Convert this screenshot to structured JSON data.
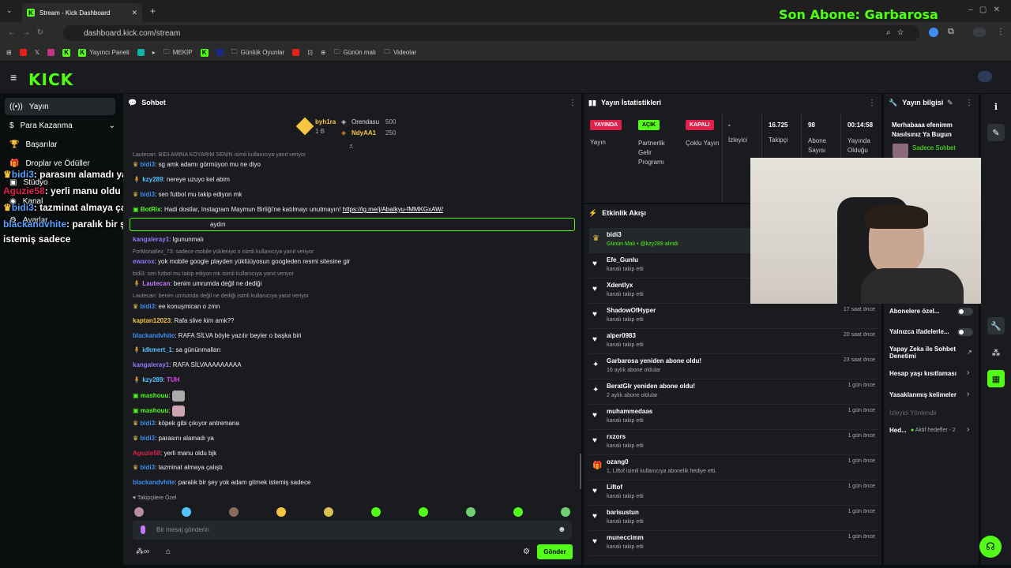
{
  "browser": {
    "tab_title": "Stream - Kick Dashboard",
    "url": "dashboard.kick.com/stream",
    "bookmarks": [
      "Yayıncı Paneli",
      "MEKİP",
      "Günlük Oyunlar",
      "Günün malı",
      "Videolar"
    ]
  },
  "overlay": {
    "last_sub": "Son Abone: Garbarosa",
    "chat_lines": [
      {
        "user": "bidi3",
        "text": ": parasını alamadı ya"
      },
      {
        "user": "Aguzie58",
        "text": ": yerli manu oldu bjk"
      },
      {
        "user": "bidi3",
        "text": ": tazminat almaya çalıştı"
      },
      {
        "user": "blackandvhite",
        "text": ": paralık bir şey yok adam gitmek"
      },
      {
        "user": "",
        "text": "istemiş sadece"
      }
    ]
  },
  "sidebar": {
    "items": [
      {
        "label": "Yayın"
      },
      {
        "label": "Para Kazanma"
      },
      {
        "label": "Başarılar"
      },
      {
        "label": "Droplar ve Ödüller"
      },
      {
        "label": "Stüdyo"
      },
      {
        "label": "Kanal"
      },
      {
        "label": "Ayarlar"
      }
    ]
  },
  "chat": {
    "title": "Sohbet",
    "leaderboard": {
      "first_user": "byh1ra",
      "first_sub": "1 B",
      "second_user": "Orendasu",
      "second_amount": "500",
      "third_user": "NdyAA1",
      "third_amount": "250"
    },
    "messages": [
      {
        "reply": "Lautecan: BİDİ AMINA KOYARIM SENİN isimli kullanıcıya yanıt veriyor",
        "user": "bidi3",
        "text": ": sg amk adamı görmüyon mu ne diyo",
        "color": "#3d8df5"
      },
      {
        "user": "kzy289",
        "text": ": nereye uzuyo kel abim",
        "color": "#53c3ff"
      },
      {
        "user": "bidi3",
        "text": ": sen futbol mu takip ediyon mk",
        "color": "#3d8df5"
      },
      {
        "user": "BotRix",
        "text": ": Hadi dostlar, Instagram Maymun Birliği'ne katılmayı unutmayın!",
        "link": "https://ig.me/j/AbaIkyu-fMMKGxAW/",
        "color": "#53fc18"
      },
      {
        "user": "",
        "text": "aydın",
        "color": "#fff"
      },
      {
        "user": "kangaleray1",
        "text": ": lgununmalı",
        "color": "#8f7af7"
      },
      {
        "reply": "ForMonatlez_73: sadece mobile yükleniyo o isimli kullanıcıya yanıt veriyor",
        "user": "ewarox",
        "text": ": yok mobile google playden yüklüüyosun googleden resmi sitesine gir",
        "color": "#8f7af7"
      },
      {
        "reply": "bidi3: sen futbol mu takip ediyon mk isimli kullanıcıya yanıt veriyor",
        "user": "Lautecan",
        "text": ": benim umrumda değil ne dediği",
        "color": "#c07af7"
      },
      {
        "reply": "Lautecan: benim umrumda değil ne dediği isimli kullanıcıya yanıt veriyor",
        "user": "bidi3",
        "text": ": ee konuşmican o zmn",
        "color": "#3d8df5"
      },
      {
        "user": "kaptan12023",
        "text": ": Rafa slive kim amk??",
        "color": "#f5c542"
      },
      {
        "user": "blackandvhite",
        "text": ": RAFA SİLVA böyle yazılır beyler o başka biri",
        "color": "#3d8df5"
      },
      {
        "user": "idkmert_1",
        "text": ": sa gününmalları",
        "color": "#53c3ff"
      },
      {
        "user": "kangaleray1",
        "text": ": RAFA SİLVAAAAAAAAA",
        "color": "#8f7af7"
      },
      {
        "user": "kzy289",
        "text": ":",
        "color": "#53c3ff"
      },
      {
        "user": "mashouu",
        "text": ":",
        "color": "#53fc18"
      },
      {
        "user": "mashouu",
        "text": ":",
        "color": "#53fc18"
      },
      {
        "user": "bidi3",
        "text": ": köpek gibi çıkıyor antremana",
        "color": "#3d8df5"
      },
      {
        "user": "bidi3",
        "text": ": parasını alamadı ya",
        "color": "#3d8df5"
      },
      {
        "user": "Aguzie58",
        "text": ": yerli manu oldu bjk",
        "color": "#e0204a"
      },
      {
        "user": "bidi3",
        "text": ": tazminat almaya çalıştı",
        "color": "#3d8df5"
      },
      {
        "user": "blackandvhite",
        "text": ": paralık bir şey yok adam gitmek istemiş sadece",
        "color": "#3d8df5"
      }
    ],
    "followers_label": "Takipçilere Özel",
    "input_placeholder": "Bir mesaj gönderin",
    "send_label": "Gönder"
  },
  "stats": {
    "title": "Yayın İstatistikleri",
    "badges": [
      {
        "badge": "YAYINDA",
        "label": "Yayın",
        "color": "#e0204a"
      },
      {
        "badge": "AÇIK",
        "label": "Partnerlik Gelir Programı",
        "color": "#53fc18"
      },
      {
        "badge": "KAPALI",
        "label": "Çoklu Yayın",
        "color": "#e0204a"
      }
    ],
    "numbers": [
      {
        "value": "-",
        "label": "İzleyici"
      },
      {
        "value": "16.725",
        "label": "Takipçi"
      },
      {
        "value": "98",
        "label": "Abone Sayısı"
      },
      {
        "value": "00:14:58",
        "label": "Yayında Olduğu"
      }
    ]
  },
  "activity": {
    "title": "Etkinlik Akışı",
    "items": [
      {
        "name": "bidi3",
        "sub": "Günün Malı • @kzy289 alındı",
        "time": "",
        "icon": "♛"
      },
      {
        "name": "Efe_Gunlu",
        "sub": "kanalı takip etti",
        "time": "",
        "icon": "♥"
      },
      {
        "name": "Xdentlyx",
        "sub": "kanalı takip etti",
        "time": "",
        "icon": "♥"
      },
      {
        "name": "ShadowOfHyper",
        "sub": "kanalı takip etti",
        "time": "17 saat önce",
        "icon": "♥"
      },
      {
        "name": "alper0983",
        "sub": "kanalı takip etti",
        "time": "20 saat önce",
        "icon": "♥"
      },
      {
        "name": "Garbarosa yeniden abone oldu!",
        "sub": "16 aylık abone oldular",
        "time": "23 saat önce",
        "icon": "✦"
      },
      {
        "name": "BeratGlr yeniden abone oldu!",
        "sub": "2 aylık abone oldular",
        "time": "1 gün önce",
        "icon": "✦"
      },
      {
        "name": "muhammedaas",
        "sub": "kanalı takip etti",
        "time": "1 gün önce",
        "icon": "♥"
      },
      {
        "name": "rxzors",
        "sub": "kanalı takip etti",
        "time": "1 gün önce",
        "icon": "♥"
      },
      {
        "name": "ozang0",
        "sub": "1, Liftof isimli kullanıcıya abonelik hediye etti.",
        "time": "1 gün önce",
        "icon": "🎁"
      },
      {
        "name": "Liftof",
        "sub": "kanalı takip etti",
        "time": "1 gün önce",
        "icon": "♥"
      },
      {
        "name": "barisustun",
        "sub": "kanalı takip etti",
        "time": "1 gün önce",
        "icon": "♥"
      },
      {
        "name": "muneccimm",
        "sub": "kanalı takip etti",
        "time": "1 gün önce",
        "icon": "♥"
      }
    ]
  },
  "info": {
    "title": "Yayın bilgisi",
    "stream_title": "Merhabaaa efenimm Nasılsınız Ya Bugun",
    "chip": "Sadece Sohbet"
  },
  "settings": {
    "rows": [
      {
        "label": "Abonelere özel..."
      },
      {
        "label": "Yalnızca ifadelerle..."
      },
      {
        "label": "Yapay Zeka ile Sohbet Denetimi"
      },
      {
        "label": "Hesap yaşı kısıtlaması"
      },
      {
        "label": "Yasaklanmış kelimeler"
      },
      {
        "label": "İzleyici Yönlendir"
      }
    ],
    "goals_label": "Hed...",
    "goals_sub": "Aktif hedefler - 2"
  }
}
